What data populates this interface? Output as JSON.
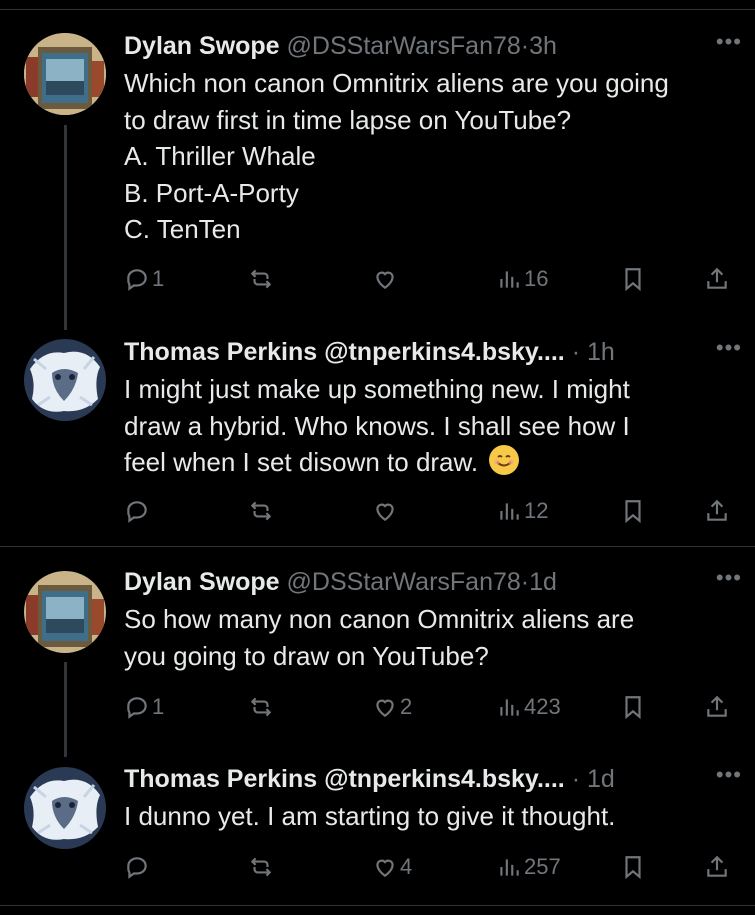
{
  "posts": [
    {
      "name": "Dylan Swope",
      "handle": "@DSStarWarsFan78",
      "dot": "·",
      "time": "3h",
      "lines": [
        "Which non canon Omnitrix aliens are you going",
        "to draw first in time lapse on YouTube?",
        "A. Thriller Whale",
        "B. Port-A-Porty",
        "C. TenTen"
      ],
      "replies": "1",
      "reposts": "",
      "likes": "",
      "views": "16"
    },
    {
      "name": "Thomas Perkins",
      "handle": "@tnperkins4.bsky....",
      "dot": "·",
      "time": "1h",
      "lines": [
        "I might just make up something new. I might",
        "draw a hybrid. Who knows. I shall see how I",
        "feel when I set disown to draw."
      ],
      "replies": "",
      "reposts": "",
      "likes": "",
      "views": "12"
    },
    {
      "name": "Dylan Swope",
      "handle": "@DSStarWarsFan78",
      "dot": "·",
      "time": "1d",
      "lines": [
        "So how many non canon Omnitrix aliens are",
        "you going to draw on YouTube?"
      ],
      "replies": "1",
      "reposts": "",
      "likes": "2",
      "views": "423"
    },
    {
      "name": "Thomas Perkins",
      "handle": "@tnperkins4.bsky....",
      "dot": "·",
      "time": "1d",
      "lines": [
        "I dunno yet. I am starting to give it thought."
      ],
      "replies": "",
      "reposts": "",
      "likes": "4",
      "views": "257"
    }
  ],
  "icons": {
    "more": "more-icon",
    "reply": "reply-icon",
    "repost": "repost-icon",
    "like": "like-icon",
    "views": "views-icon",
    "bookmark": "bookmark-icon",
    "share": "share-icon",
    "emoji": "smiling-face-icon"
  },
  "colors": {
    "background": "#000000",
    "text": "#e7e9ea",
    "secondary": "#71767b",
    "divider": "#2f3336"
  }
}
